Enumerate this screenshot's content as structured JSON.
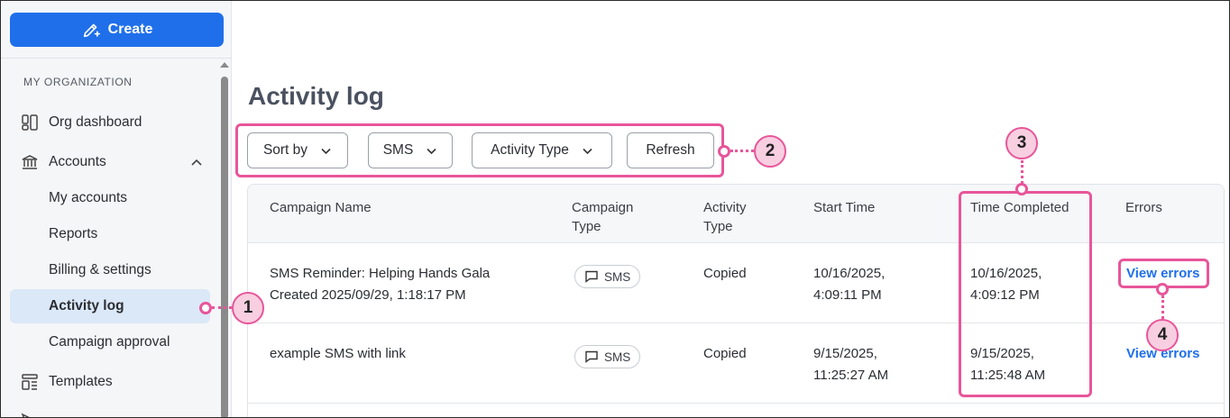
{
  "sidebar": {
    "create_label": "Create",
    "section_label": "MY ORGANIZATION",
    "items": [
      {
        "label": "Org dashboard"
      },
      {
        "label": "Accounts"
      },
      {
        "label": "My accounts"
      },
      {
        "label": "Reports"
      },
      {
        "label": "Billing & settings"
      },
      {
        "label": "Activity log"
      },
      {
        "label": "Campaign approval"
      },
      {
        "label": "Templates"
      }
    ]
  },
  "main": {
    "title": "Activity log",
    "filters": {
      "sort_by": "Sort by",
      "channel": "SMS",
      "activity_type": "Activity Type",
      "refresh": "Refresh"
    },
    "table": {
      "headers": {
        "campaign_name": "Campaign Name",
        "campaign_type_1": "Campaign",
        "campaign_type_2": "Type",
        "activity_type_1": "Activity",
        "activity_type_2": "Type",
        "start_time": "Start Time",
        "time_completed": "Time Completed",
        "errors": "Errors"
      },
      "rows": [
        {
          "name_1": "SMS Reminder: Helping Hands Gala",
          "name_2": "Created 2025/09/29, 1:18:17 PM",
          "type": "SMS",
          "activity": "Copied",
          "start_1": "10/16/2025,",
          "start_2": "4:09:11 PM",
          "completed_1": "10/16/2025,",
          "completed_2": "4:09:12 PM",
          "errors": "View errors"
        },
        {
          "name_1": "example SMS with link",
          "name_2": "",
          "type": "SMS",
          "activity": "Copied",
          "start_1": "9/15/2025,",
          "start_2": "11:25:27 AM",
          "completed_1": "9/15/2025,",
          "completed_2": "11:25:48 AM",
          "errors": "View errors"
        }
      ]
    }
  },
  "annotations": [
    "1",
    "2",
    "3",
    "4"
  ],
  "colors": {
    "primary": "#1f6feb",
    "annotation": "#e8559a",
    "annotation_fill": "#f7cfe0",
    "active_nav": "#dbe8f7"
  }
}
